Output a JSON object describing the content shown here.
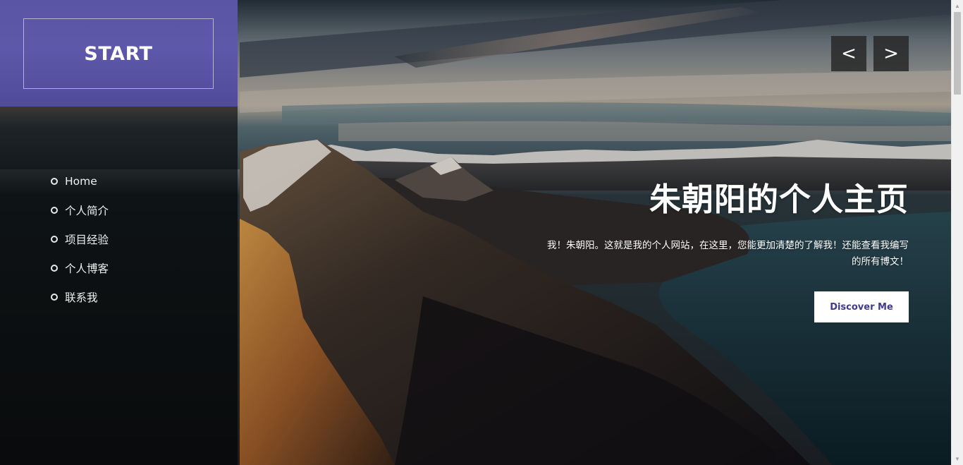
{
  "sidebar": {
    "logo": "START",
    "nav": [
      {
        "label": "Home"
      },
      {
        "label": "个人简介"
      },
      {
        "label": "项目经验"
      },
      {
        "label": "个人博客"
      },
      {
        "label": "联系我"
      }
    ]
  },
  "slider": {
    "prev_label": "<",
    "next_label": ">"
  },
  "hero": {
    "title": "朱朝阳的个人主页",
    "description": "我！朱朝阳。这就是我的个人网站，在这里，您能更加清楚的了解我！还能查看我编写的所有博文！",
    "cta_label": "Discover Me"
  },
  "colors": {
    "accent": "#5b55a5",
    "cta_text": "#3f3b8a"
  },
  "icons": {
    "nav_bullet": "circle-bullet-icon",
    "prev": "chevron-left-icon",
    "next": "chevron-right-icon"
  }
}
